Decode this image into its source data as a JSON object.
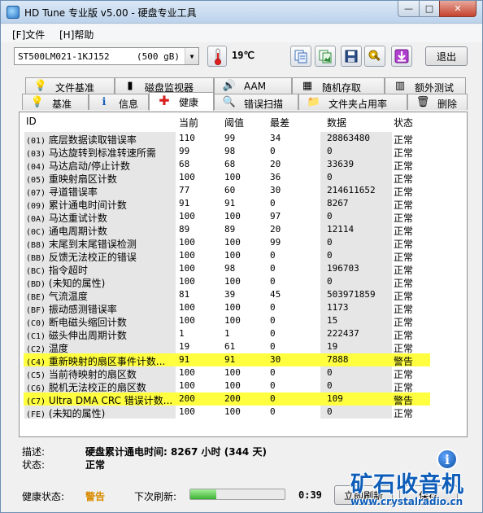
{
  "window": {
    "title": "HD Tune 专业版 v5.00 - 硬盘专业工具",
    "min_glyph": "—",
    "max_glyph": "□",
    "close_glyph": "✕"
  },
  "menu": [
    {
      "label": "[F]文件"
    },
    {
      "label": "[H]帮助"
    }
  ],
  "toolbar": {
    "drive_name": "ST500LM021-1KJ152",
    "drive_size": "(500 gB)",
    "temperature": "19℃",
    "exit_label": "退出"
  },
  "tabs_row1": [
    {
      "label": "文件基准",
      "icon": "file-benchmark-icon",
      "glyph": "💡"
    },
    {
      "label": "磁盘监视器",
      "icon": "disk-monitor-icon",
      "glyph": "▮"
    },
    {
      "label": "AAM",
      "icon": "speaker-icon",
      "glyph": "🔊"
    },
    {
      "label": "随机存取",
      "icon": "random-access-icon",
      "glyph": "▦"
    },
    {
      "label": "额外测试",
      "icon": "extra-tests-icon",
      "glyph": "▥"
    }
  ],
  "tabs_row2": [
    {
      "label": "基准",
      "icon": "benchmark-icon",
      "glyph": "💡"
    },
    {
      "label": "信息",
      "icon": "info-icon",
      "glyph": "ℹ"
    },
    {
      "label": "健康",
      "icon": "health-cross-icon",
      "glyph": "✚"
    },
    {
      "label": "错误扫描",
      "icon": "error-scan-icon",
      "glyph": "🔍"
    },
    {
      "label": "文件夹占用率",
      "icon": "folder-usage-icon",
      "glyph": "📁"
    },
    {
      "label": "删除",
      "icon": "delete-icon",
      "glyph": "🗑"
    }
  ],
  "active_tab": "健康",
  "smart": {
    "columns": [
      "ID",
      "当前",
      "阈值",
      "最差",
      "数据",
      "状态"
    ],
    "rows": [
      {
        "id": "(01)",
        "name": "底层数据读取错误率",
        "current": "110",
        "threshold": "99",
        "worst": "34",
        "data": "28863480",
        "status": "正常",
        "warn": false
      },
      {
        "id": "(03)",
        "name": "马达旋转到标准转速所需",
        "current": "99",
        "threshold": "98",
        "worst": "0",
        "data": "0",
        "status": "正常",
        "warn": false
      },
      {
        "id": "(04)",
        "name": "马达启动/停止计数",
        "current": "68",
        "threshold": "68",
        "worst": "20",
        "data": "33639",
        "status": "正常",
        "warn": false
      },
      {
        "id": "(05)",
        "name": "重映射扇区计数",
        "current": "100",
        "threshold": "100",
        "worst": "36",
        "data": "0",
        "status": "正常",
        "warn": false
      },
      {
        "id": "(07)",
        "name": "寻道错误率",
        "current": "77",
        "threshold": "60",
        "worst": "30",
        "data": "214611652",
        "status": "正常",
        "warn": false
      },
      {
        "id": "(09)",
        "name": "累计通电时间计数",
        "current": "91",
        "threshold": "91",
        "worst": "0",
        "data": "8267",
        "status": "正常",
        "warn": false
      },
      {
        "id": "(0A)",
        "name": "马达重试计数",
        "current": "100",
        "threshold": "100",
        "worst": "97",
        "data": "0",
        "status": "正常",
        "warn": false
      },
      {
        "id": "(0C)",
        "name": "通电周期计数",
        "current": "89",
        "threshold": "89",
        "worst": "20",
        "data": "12114",
        "status": "正常",
        "warn": false
      },
      {
        "id": "(B8)",
        "name": "末尾到末尾错误检测",
        "current": "100",
        "threshold": "100",
        "worst": "99",
        "data": "0",
        "status": "正常",
        "warn": false
      },
      {
        "id": "(BB)",
        "name": "反馈无法校正的错误",
        "current": "100",
        "threshold": "100",
        "worst": "0",
        "data": "0",
        "status": "正常",
        "warn": false
      },
      {
        "id": "(BC)",
        "name": "指令超时",
        "current": "100",
        "threshold": "98",
        "worst": "0",
        "data": "196703",
        "status": "正常",
        "warn": false
      },
      {
        "id": "(BD)",
        "name": "(未知的属性)",
        "current": "100",
        "threshold": "100",
        "worst": "0",
        "data": "0",
        "status": "正常",
        "warn": false
      },
      {
        "id": "(BE)",
        "name": "气流温度",
        "current": "81",
        "threshold": "39",
        "worst": "45",
        "data": "503971859",
        "status": "正常",
        "warn": false
      },
      {
        "id": "(BF)",
        "name": "振动感测错误率",
        "current": "100",
        "threshold": "100",
        "worst": "0",
        "data": "1173",
        "status": "正常",
        "warn": false
      },
      {
        "id": "(C0)",
        "name": "断电磁头缩回计数",
        "current": "100",
        "threshold": "100",
        "worst": "0",
        "data": "15",
        "status": "正常",
        "warn": false
      },
      {
        "id": "(C1)",
        "name": "磁头伸出周期计数",
        "current": "1",
        "threshold": "1",
        "worst": "0",
        "data": "222437",
        "status": "正常",
        "warn": false
      },
      {
        "id": "(C2)",
        "name": "温度",
        "current": "19",
        "threshold": "61",
        "worst": "0",
        "data": "19",
        "status": "正常",
        "warn": false
      },
      {
        "id": "(C4)",
        "name": "重新映射的扇区事件计数...",
        "current": "91",
        "threshold": "91",
        "worst": "30",
        "data": "7888",
        "status": "警告",
        "warn": true
      },
      {
        "id": "(C5)",
        "name": "当前待映射的扇区数",
        "current": "100",
        "threshold": "100",
        "worst": "0",
        "data": "0",
        "status": "正常",
        "warn": false
      },
      {
        "id": "(C6)",
        "name": "脱机无法校正的扇区数",
        "current": "100",
        "threshold": "100",
        "worst": "0",
        "data": "0",
        "status": "正常",
        "warn": false
      },
      {
        "id": "(C7)",
        "name": "Ultra DMA CRC 错误计数...",
        "current": "200",
        "threshold": "200",
        "worst": "0",
        "data": "109",
        "status": "警告",
        "warn": true
      },
      {
        "id": "(FE)",
        "name": "(未知的属性)",
        "current": "100",
        "threshold": "100",
        "worst": "0",
        "data": "0",
        "status": "正常",
        "warn": false
      }
    ]
  },
  "details": {
    "desc_label": "描述:",
    "desc_value": "硬盘累计通电时间: 8267 小时 (344 天)",
    "status_label": "状态:",
    "status_value": "正常"
  },
  "status_bar": {
    "health_label": "健康状态:",
    "health_value": "警告",
    "next_refresh_label": "下次刷新:",
    "progress": 0.28,
    "timer": "0:39",
    "refresh_button": "立即刷新",
    "save_button": "保存"
  },
  "watermark": {
    "badge": "i",
    "brand": "矿石收音机",
    "url": "www.crystalradio.cn"
  },
  "colors": {
    "warning_row": "#ffff40",
    "health_warning": "#d98b00",
    "watermark_blue": "#0e5db8"
  }
}
